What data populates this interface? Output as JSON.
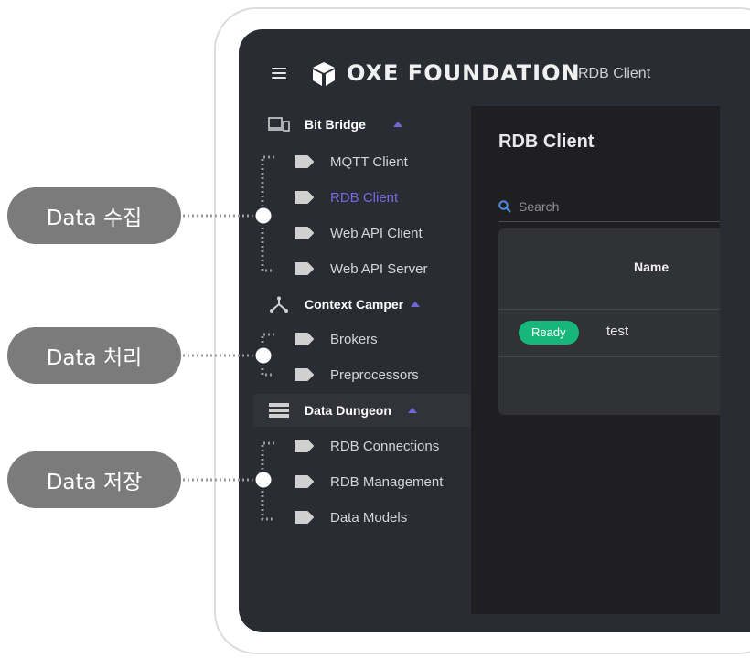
{
  "app": {
    "brand": "OXE FOUNDATION",
    "title": "RDB Client"
  },
  "sidebar": {
    "groups": [
      {
        "label": "Bit Bridge",
        "icon": "devices-icon",
        "items": [
          "MQTT Client",
          "RDB Client",
          "Web API Client",
          "Web API Server"
        ]
      },
      {
        "label": "Context Camper",
        "icon": "hub-icon",
        "items": [
          "Brokers",
          "Preprocessors"
        ]
      },
      {
        "label": "Data Dungeon",
        "icon": "database-icon",
        "items": [
          "RDB Connections",
          "RDB Management",
          "Data Models"
        ]
      }
    ],
    "selected_item": "RDB Client"
  },
  "main": {
    "page_title": "RDB Client",
    "search_placeholder": "Search",
    "table": {
      "columns": [
        "Name"
      ],
      "rows": [
        {
          "status": "Ready",
          "name": "test"
        }
      ]
    }
  },
  "annotations": [
    "Data 수집",
    "Data 처리",
    "Data 저장"
  ],
  "colors": {
    "accent": "#7a68e0",
    "ready_badge": "#17b67a",
    "sidebar_bg": "#2a2c33",
    "main_bg": "#1f1f21",
    "callout_bg": "#7b7b7b"
  }
}
